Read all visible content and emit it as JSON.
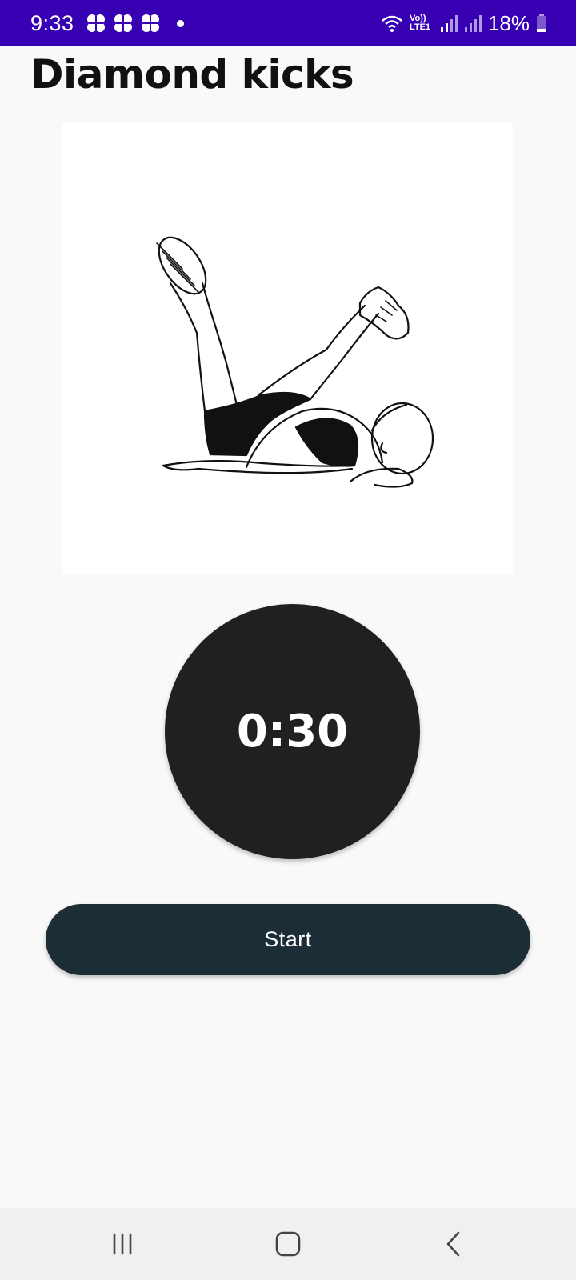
{
  "status_bar": {
    "time": "9:33",
    "battery": "18%",
    "network": "Vo)) LTE1",
    "icons": [
      "clover-notification-icon",
      "clover-notification-icon",
      "clover-notification-icon",
      "dot-icon",
      "wifi-icon",
      "signal-icon",
      "signal-icon",
      "battery-icon"
    ]
  },
  "exercise": {
    "title": "Diamond kicks",
    "illustration": "woman lying on back kicking legs"
  },
  "timer": {
    "display": "0:30"
  },
  "actions": {
    "start_label": "Start"
  },
  "nav": {
    "icons": [
      "recents-icon",
      "home-icon",
      "back-icon"
    ]
  },
  "colors": {
    "status_bar": "#3700b3",
    "timer_bg": "#212021",
    "button_bg": "#1c2d35",
    "page_bg": "#f9f9f9"
  }
}
